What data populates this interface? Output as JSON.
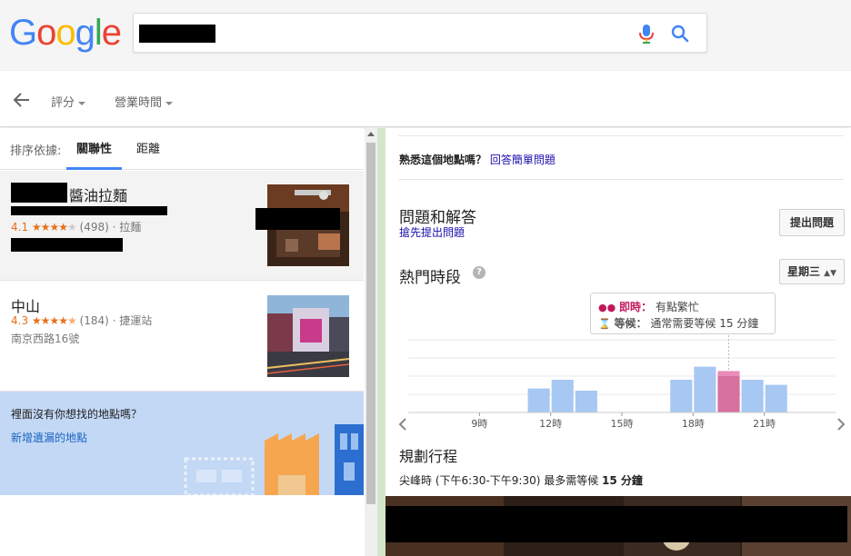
{
  "header": {
    "logo_letters": [
      {
        "ch": "G",
        "color": "#4285F4"
      },
      {
        "ch": "o",
        "color": "#EA4335"
      },
      {
        "ch": "o",
        "color": "#FBBC05"
      },
      {
        "ch": "g",
        "color": "#4285F4"
      },
      {
        "ch": "l",
        "color": "#34A853"
      },
      {
        "ch": "e",
        "color": "#EA4335"
      }
    ],
    "mic_icon": "microphone-icon",
    "search_icon": "search-icon"
  },
  "filters": {
    "back_icon": "arrow-back-icon",
    "rating": "評分",
    "hours": "營業時間"
  },
  "sort": {
    "label": "排序依據:",
    "relevance": "關聯性",
    "distance": "距離"
  },
  "results": [
    {
      "title": "醬油拉麵",
      "rating": "4.1",
      "stars_full": 4,
      "stars_empty": 1,
      "reviews": "(498)",
      "category": "· 拉麵",
      "address": ""
    },
    {
      "title": "中山",
      "rating": "4.3",
      "stars_full": 4,
      "stars_empty": 0,
      "reviews": "(184)",
      "category": "· 捷運站",
      "address": "南京西路16號"
    }
  ],
  "promo": {
    "question": "裡面沒有你想找的地點嗎？",
    "link": "新增遺漏的地點"
  },
  "details": {
    "know_question": "熟悉這個地點嗎？",
    "know_link": "回答簡單問題",
    "qa_title": "問題和解答",
    "qa_link": "搶先提出問題",
    "ask_button": "提出問題",
    "popular_title": "熱門時段",
    "day_select": "星期三",
    "live_label": "即時：",
    "live_value": "有點繁忙",
    "wait_label": "等候：",
    "wait_value": "通常需要等候 15 分鐘",
    "plan_title": "規劃行程",
    "plan_text": "尖峰時 (下午6:30-下午9:30) 最多需等候",
    "plan_wait": "15 分鐘"
  },
  "chart_data": {
    "type": "bar",
    "x": [
      6,
      7,
      8,
      9,
      10,
      11,
      12,
      13,
      14,
      15,
      16,
      17,
      18,
      19,
      20,
      21,
      22,
      23
    ],
    "tick_labels": [
      "9時",
      "12時",
      "15時",
      "18時",
      "21時"
    ],
    "tick_positions": [
      9,
      12,
      15,
      18,
      21
    ],
    "values": [
      0,
      0,
      0,
      0,
      0,
      33,
      45,
      30,
      0,
      0,
      0,
      45,
      63,
      57,
      45,
      38,
      0,
      0
    ],
    "live_hour": 19,
    "live_value": 50,
    "colors": {
      "bar": "#a6c8f3",
      "live": "#d6709f",
      "live_top": "#e98cb8"
    },
    "ylim": [
      0,
      100
    ],
    "grid": true
  },
  "colors": {
    "link": "#1a0dab",
    "accent": "#4285f4",
    "star": "#e7711b",
    "promo_bg": "#c3d8f5"
  }
}
